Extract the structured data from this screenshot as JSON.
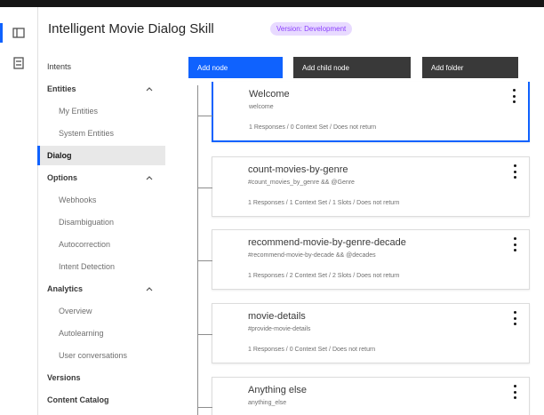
{
  "app": {
    "title": "Intelligent Movie Dialog Skill",
    "status_tag": "Version: Development"
  },
  "rail": {
    "icons": [
      "skills-icon",
      "assistant-icon"
    ]
  },
  "sidebar": {
    "items": [
      {
        "label": "Intents",
        "kind": "plain"
      },
      {
        "label": "Entities",
        "kind": "head",
        "expanded": true
      },
      {
        "label": "My Entities",
        "kind": "sub"
      },
      {
        "label": "System Entities",
        "kind": "sub"
      },
      {
        "label": "Dialog",
        "kind": "selected"
      },
      {
        "label": "Options",
        "kind": "head",
        "expanded": true
      },
      {
        "label": "Webhooks",
        "kind": "sub"
      },
      {
        "label": "Disambiguation",
        "kind": "sub"
      },
      {
        "label": "Autocorrection",
        "kind": "sub"
      },
      {
        "label": "Intent Detection",
        "kind": "sub"
      },
      {
        "label": "Analytics",
        "kind": "head",
        "expanded": true
      },
      {
        "label": "Overview",
        "kind": "sub"
      },
      {
        "label": "Autolearning",
        "kind": "sub"
      },
      {
        "label": "User conversations",
        "kind": "sub"
      },
      {
        "label": "Versions",
        "kind": "head"
      },
      {
        "label": "Content Catalog",
        "kind": "head"
      }
    ]
  },
  "toolbar": {
    "add_node": "Add node",
    "add_child_node": "Add child node",
    "add_folder": "Add folder"
  },
  "nodes": [
    {
      "title": "Welcome",
      "condition": "welcome",
      "meta": "1 Responses / 0 Context Set / Does not return",
      "selected": true
    },
    {
      "title": "count-movies-by-genre",
      "condition": "#count_movies_by_genre && @Genre",
      "meta": "1 Responses / 1 Context Set / 1 Slots / Does not return",
      "selected": false
    },
    {
      "title": "recommend-movie-by-genre-decade",
      "condition": "#recommend-movie-by-decade && @decades",
      "meta": "1 Responses / 2 Context Set / 2 Slots / Does not return",
      "selected": false
    },
    {
      "title": "movie-details",
      "condition": "#provide-movie-details",
      "meta": "1 Responses / 0 Context Set / Does not return",
      "selected": false
    },
    {
      "title": "Anything else",
      "condition": "anything_else",
      "meta": "",
      "selected": false
    }
  ]
}
